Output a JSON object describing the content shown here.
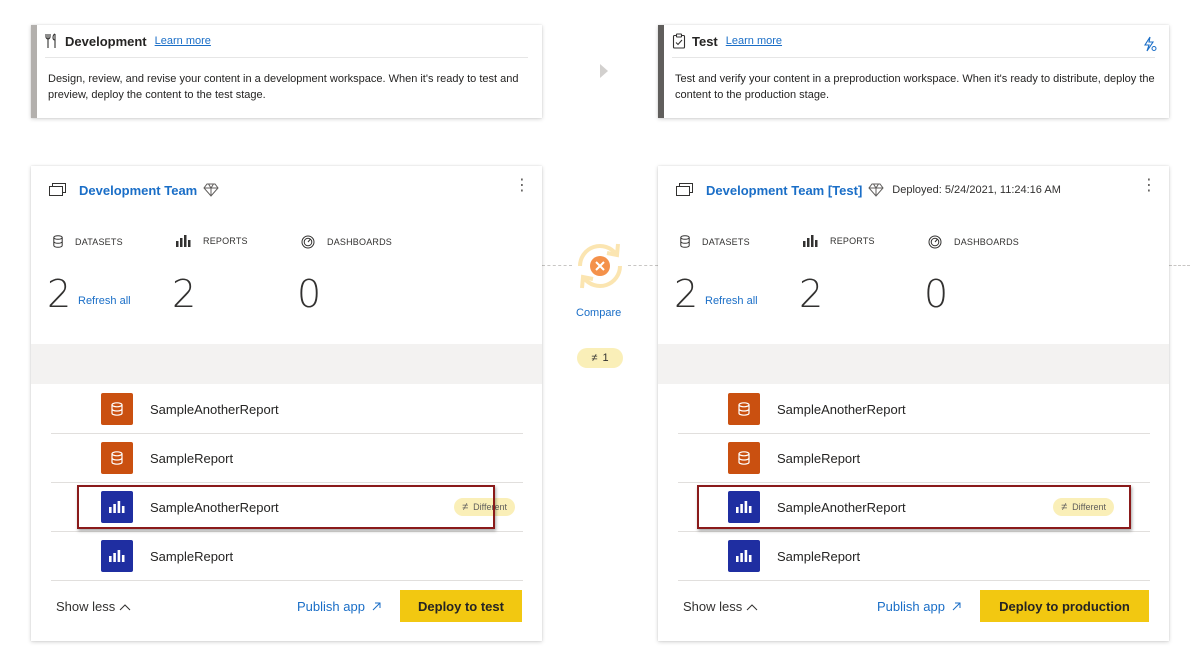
{
  "stages": [
    {
      "name": "Development",
      "learn_more": "Learn more",
      "description": "Design, review, and revise your content in a development workspace. When it's ready to test and preview, deploy the content to the test stage.",
      "bar_color": "#b3b0ad"
    },
    {
      "name": "Test",
      "learn_more": "Learn more",
      "description": "Test and verify your content in a preproduction workspace. When it's ready to distribute, deploy the content to the production stage.",
      "bar_color": "#605e5c"
    }
  ],
  "workspaces": [
    {
      "title": "Development Team",
      "deployed": "",
      "metrics": {
        "datasets_label": "DATASETS",
        "datasets_count": "2",
        "refresh_all": "Refresh all",
        "reports_label": "REPORTS",
        "reports_count": "2",
        "dashboards_label": "DASHBOARDS",
        "dashboards_count": "0"
      },
      "items": [
        {
          "type": "dataset",
          "name": "SampleAnotherReport"
        },
        {
          "type": "dataset",
          "name": "SampleReport"
        },
        {
          "type": "report",
          "name": "SampleAnotherReport",
          "badge": "Different"
        },
        {
          "type": "report",
          "name": "SampleReport"
        }
      ],
      "show_less": "Show less",
      "publish_app": "Publish app",
      "deploy_label": "Deploy to test"
    },
    {
      "title": "Development Team [Test]",
      "deployed": "Deployed: 5/24/2021, 11:24:16 AM",
      "metrics": {
        "datasets_label": "DATASETS",
        "datasets_count": "2",
        "refresh_all": "Refresh all",
        "reports_label": "REPORTS",
        "reports_count": "2",
        "dashboards_label": "DASHBOARDS",
        "dashboards_count": "0"
      },
      "items": [
        {
          "type": "dataset",
          "name": "SampleAnotherReport"
        },
        {
          "type": "dataset",
          "name": "SampleReport"
        },
        {
          "type": "report",
          "name": "SampleAnotherReport",
          "badge": "Different"
        },
        {
          "type": "report",
          "name": "SampleReport"
        }
      ],
      "show_less": "Show less",
      "publish_app": "Publish app",
      "deploy_label": "Deploy to production"
    }
  ],
  "compare": {
    "label": "Compare",
    "diff_symbol": "≠",
    "diff_count": "1"
  },
  "colors": {
    "accent_link": "#1a6ec7",
    "deploy_button": "#f2c811",
    "dataset_icon": "#ca5010",
    "report_icon": "#1f2ea1",
    "different_badge": "#faefb8",
    "highlight_border": "#8a1a1a"
  }
}
